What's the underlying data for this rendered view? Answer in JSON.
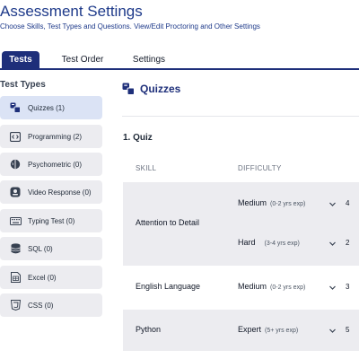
{
  "header": {
    "title": "Assessment Settings",
    "subtitle": "Choose Skills, Test Types and Questions. View/Edit Proctoring and Other Settings"
  },
  "tabs": [
    {
      "label": "Tests",
      "active": true
    },
    {
      "label": "Test Order",
      "active": false
    },
    {
      "label": "Settings",
      "active": false
    }
  ],
  "sidebar": {
    "title": "Test Types",
    "items": [
      {
        "label": "Quizzes (1)",
        "icon": "quiz-icon",
        "active": true
      },
      {
        "label": "Programming (2)",
        "icon": "code-icon",
        "active": false
      },
      {
        "label": "Psychometric (0)",
        "icon": "brain-icon",
        "active": false
      },
      {
        "label": "Video Response (0)",
        "icon": "video-icon",
        "active": false
      },
      {
        "label": "Typing Test (0)",
        "icon": "keyboard-icon",
        "active": false
      },
      {
        "label": "SQL (0)",
        "icon": "database-icon",
        "active": false
      },
      {
        "label": "Excel (0)",
        "icon": "excel-icon",
        "active": false
      },
      {
        "label": "CSS (0)",
        "icon": "css-icon",
        "active": false
      }
    ]
  },
  "main": {
    "title": "Quizzes",
    "quiz_heading": "1. Quiz",
    "col_skill": "SKILL",
    "col_difficulty": "DIFFICULTY",
    "rows": [
      {
        "skill": "Attention to Detail",
        "levels": [
          {
            "difficulty": "Medium",
            "exp": "(0-2 yrs exp)",
            "count": "4"
          },
          {
            "difficulty": "Hard",
            "exp": "(3-4 yrs exp)",
            "count": "2"
          }
        ]
      },
      {
        "skill": "English Language",
        "levels": [
          {
            "difficulty": "Medium",
            "exp": "(0-2 yrs exp)",
            "count": "3"
          }
        ]
      },
      {
        "skill": "Python",
        "levels": [
          {
            "difficulty": "Expert",
            "exp": "(5+ yrs exp)",
            "count": "5"
          }
        ]
      }
    ]
  },
  "colors": {
    "primary": "#1e2f7a",
    "sidebar_bg": "#ececf0",
    "sidebar_active_bg": "#dbe3f5"
  }
}
